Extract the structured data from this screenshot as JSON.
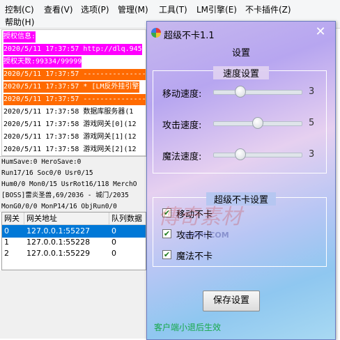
{
  "menubar": {
    "items": [
      "控制(C)",
      "查看(V)",
      "选项(P)",
      "管理(M)",
      "工具(T)",
      "LM引擎(E)",
      "不卡插件(Z)",
      "帮助(H)"
    ]
  },
  "log": {
    "lines": [
      {
        "text": "授权信息:",
        "bg": "#ff00ff",
        "color": "#ffffff"
      },
      {
        "text": "2020/5/11 17:37:57 http://dlq.945",
        "bg": "#ff00ff",
        "color": "#ffffff"
      },
      {
        "text": "授权天数:99334/99999",
        "bg": "#ff00ff",
        "color": "#ffffff"
      },
      {
        "text": "2020/5/11 17:37:57 ----------------",
        "bg": "#ff6a00",
        "color": "#ffffff"
      },
      {
        "text": "2020/5/11 17:37:57 * [LM反外挂引擎",
        "bg": "#ff6a00",
        "color": "#ffffff"
      },
      {
        "text": "2020/5/11 17:37:57 ----------------",
        "bg": "#ff6a00",
        "color": "#ffffff"
      },
      {
        "text": "2020/5/11 17:37:58 数据库服务器(1",
        "bg": "#ffffff",
        "color": "#000000"
      },
      {
        "text": "2020/5/11 17:37:58 游戏网关[0](12",
        "bg": "#ffffff",
        "color": "#000000"
      },
      {
        "text": "2020/5/11 17:37:58 游戏网关[1](12",
        "bg": "#ffffff",
        "color": "#000000"
      },
      {
        "text": "2020/5/11 17:37:58 游戏网关[2](12",
        "bg": "#ffffff",
        "color": "#000000"
      }
    ]
  },
  "status": {
    "lines": [
      "HumSave:0 HeroSave:0",
      "Run17/16 Soc0/0 Usr0/15",
      "Hum0/0 Mon0/15 UsrRot16/118 MerchO",
      "[BOSS]雷炎圣兽,69/2036 - 城门/2035",
      "MonG0/0/0 MonP14/16 ObjRun0/0"
    ]
  },
  "grid": {
    "headers": [
      "网关",
      "网关地址",
      "队列数据"
    ],
    "rows": [
      [
        "0",
        "127.0.0.1:55227",
        "0"
      ],
      [
        "1",
        "127.0.0.1:55228",
        "0"
      ],
      [
        "2",
        "127.0.0.1:55229",
        "0"
      ]
    ]
  },
  "dialog": {
    "title": "超级不卡1.1",
    "close_glyph": "✕",
    "section_title": "设置",
    "speed_group": {
      "title": "速度设置",
      "sliders": [
        {
          "label": "移动速度:",
          "value": "3",
          "fraction": 0.3
        },
        {
          "label": "攻击速度:",
          "value": "5",
          "fraction": 0.5
        },
        {
          "label": "魔法速度:",
          "value": "3",
          "fraction": 0.3
        }
      ]
    },
    "nolag_group": {
      "title": "超级不卡设置",
      "checkboxes": [
        {
          "label": "移动不卡",
          "checked": true
        },
        {
          "label": "攻击不卡",
          "checked": true
        },
        {
          "label": "魔法不卡",
          "checked": true
        }
      ]
    },
    "save_button": "保存设置",
    "footer_note": "客户端小退后生效",
    "watermark_text": "500PI.COM",
    "colors": {
      "accent_green": "#17a84a",
      "selected_row": "#0078d7"
    }
  }
}
